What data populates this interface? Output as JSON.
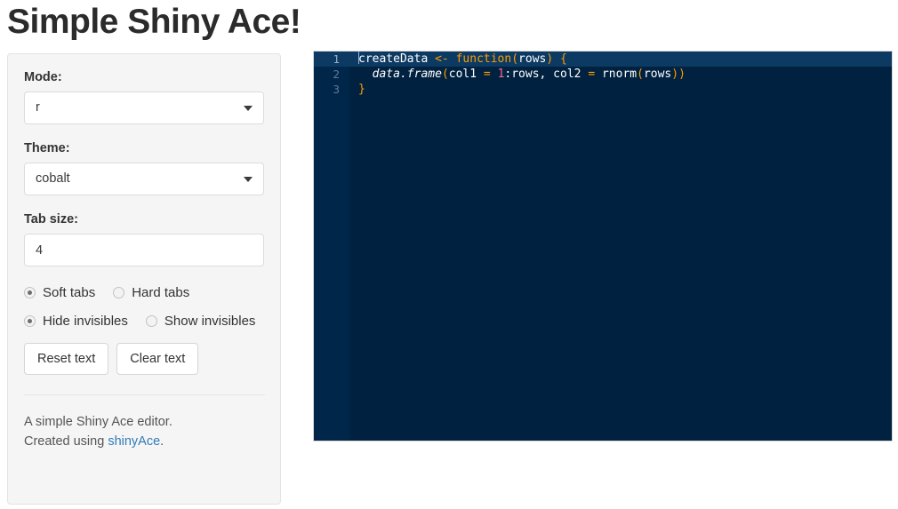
{
  "app": {
    "title": "Simple Shiny Ace!"
  },
  "sidebar": {
    "mode": {
      "label": "Mode:",
      "value": "r",
      "icon": "chevron-down-icon"
    },
    "theme": {
      "label": "Theme:",
      "value": "cobalt",
      "icon": "chevron-down-icon"
    },
    "tab_size": {
      "label": "Tab size:",
      "value": "4",
      "placeholder": ""
    },
    "tab_type_radios": [
      {
        "label": "Soft tabs",
        "checked": true
      },
      {
        "label": "Hard tabs",
        "checked": false
      }
    ],
    "invisibles_radios": [
      {
        "label": "Hide invisibles",
        "checked": true
      },
      {
        "label": "Show invisibles",
        "checked": false
      }
    ],
    "buttons": [
      {
        "label": "Reset text",
        "name": "reset-text-button"
      },
      {
        "label": "Clear text",
        "name": "clear-text-button"
      }
    ],
    "footer": {
      "line1": "A simple Shiny Ace editor.",
      "line2_prefix": "Created using ",
      "link_text": "shinyAce",
      "line2_suffix": ".",
      "link_color": "#337ab7"
    }
  },
  "editor": {
    "theme_name": "cobalt",
    "background": "#002240",
    "gutter_background": "#00264a",
    "active_line_background": "#0c3a63",
    "gutter_numbers": [
      "1",
      "2",
      "3"
    ],
    "lines": [
      {
        "number": "1",
        "active": true,
        "raw": "createData <- function(rows) {",
        "tokens": [
          {
            "text": "createData",
            "type": "plain"
          },
          {
            "text": " ",
            "type": "plain"
          },
          {
            "text": "<-",
            "type": "op"
          },
          {
            "text": " ",
            "type": "plain"
          },
          {
            "text": "function",
            "type": "keyword"
          },
          {
            "text": "(",
            "type": "paren"
          },
          {
            "text": "rows",
            "type": "plain"
          },
          {
            "text": ")",
            "type": "paren"
          },
          {
            "text": " ",
            "type": "plain"
          },
          {
            "text": "{",
            "type": "paren"
          }
        ]
      },
      {
        "number": "2",
        "active": false,
        "raw": "  data.frame(col1 = 1:rows, col2 = rnorm(rows))",
        "tokens": [
          {
            "text": "  ",
            "type": "plain"
          },
          {
            "text": "data.frame",
            "type": "fn"
          },
          {
            "text": "(",
            "type": "paren"
          },
          {
            "text": "col1",
            "type": "plain"
          },
          {
            "text": " ",
            "type": "plain"
          },
          {
            "text": "=",
            "type": "op"
          },
          {
            "text": " ",
            "type": "plain"
          },
          {
            "text": "1",
            "type": "num"
          },
          {
            "text": ":rows, col2",
            "type": "plain"
          },
          {
            "text": " ",
            "type": "plain"
          },
          {
            "text": "=",
            "type": "op"
          },
          {
            "text": " ",
            "type": "plain"
          },
          {
            "text": "rnorm",
            "type": "plain"
          },
          {
            "text": "(",
            "type": "paren"
          },
          {
            "text": "rows",
            "type": "plain"
          },
          {
            "text": "))",
            "type": "paren"
          }
        ]
      },
      {
        "number": "3",
        "active": false,
        "raw": "}",
        "tokens": [
          {
            "text": "}",
            "type": "paren"
          }
        ]
      }
    ]
  }
}
